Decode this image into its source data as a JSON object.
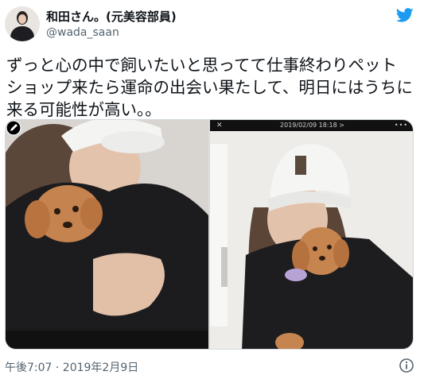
{
  "author": {
    "display_name": "和田さん。(元美容部員)",
    "handle": "@wada_saan"
  },
  "tweet": {
    "lines": [
      "ずっと心の中で飼いたいと思ってて仕事終わりペット",
      "ショップ来たら運命の出会い果たして、明日にはうちに",
      "来る可能性が高い。。"
    ]
  },
  "media": {
    "right_photo_header": "2019/02/09 18:18 >"
  },
  "footer": {
    "timestamp": "午後7:07 · 2019年2月9日"
  },
  "icons": {
    "brand": "twitter-bird-icon",
    "info": "info-icon",
    "edit": "edit-pen-icon"
  },
  "colors": {
    "brand": "#1d9bf0",
    "secondary_text": "#536471"
  }
}
